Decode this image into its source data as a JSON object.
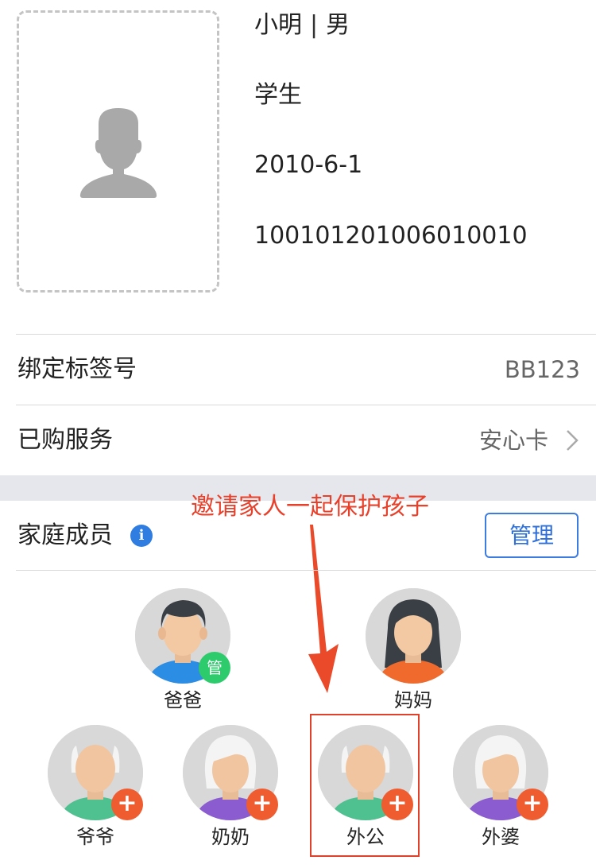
{
  "profile": {
    "name": "小明",
    "gender": "男",
    "role": "学生",
    "birthday": "2010-6-1",
    "id_number": "100101201006010010",
    "photo_icon": "person-placeholder-icon"
  },
  "rows": {
    "tag_label": "绑定标签号",
    "tag_value": "BB123",
    "service_label": "已购服务",
    "service_value": "安心卡"
  },
  "family": {
    "title": "家庭成员",
    "info_icon_glyph": "i",
    "manage_label": "管理",
    "callout": "邀请家人一起保护孩子",
    "members": [
      {
        "name": "爸爸",
        "badge": "管",
        "badge_type": "admin"
      },
      {
        "name": "妈妈"
      },
      {
        "name": "爷爷",
        "badge": "+",
        "badge_type": "add"
      },
      {
        "name": "奶奶",
        "badge": "+",
        "badge_type": "add"
      },
      {
        "name": "外公",
        "badge": "+",
        "badge_type": "add"
      },
      {
        "name": "外婆",
        "badge": "+",
        "badge_type": "add"
      }
    ]
  },
  "colors": {
    "accent_blue": "#2f6fd8",
    "callout_red": "#e8412b",
    "admin_green": "#2dcb6c",
    "add_orange": "#ef5c2f"
  }
}
